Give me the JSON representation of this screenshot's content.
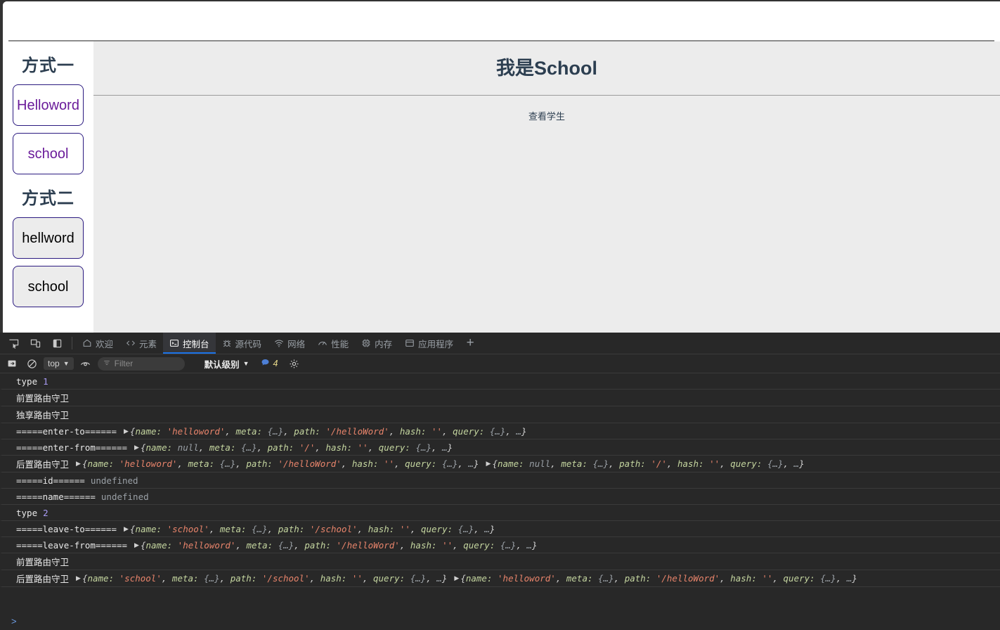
{
  "page": {
    "side_nav": {
      "section_one_heading": "方式一",
      "section_one_items": [
        {
          "label": "Helloword",
          "name": "nav-link-helloword"
        },
        {
          "label": "school",
          "name": "nav-link-school"
        }
      ],
      "section_two_heading": "方式二",
      "section_two_items": [
        {
          "label": "hellword",
          "name": "nav-button-hellword"
        },
        {
          "label": "school",
          "name": "nav-button-school"
        }
      ]
    },
    "content": {
      "title": "我是School",
      "sub_link": "查看学生"
    }
  },
  "devtools": {
    "tabs": [
      {
        "label": "欢迎",
        "icon": "home-icon",
        "active": false
      },
      {
        "label": "元素",
        "icon": "code-icon",
        "active": false
      },
      {
        "label": "控制台",
        "icon": "console-icon",
        "active": true
      },
      {
        "label": "源代码",
        "icon": "bug-icon",
        "active": false
      },
      {
        "label": "网络",
        "icon": "wifi-icon",
        "active": false
      },
      {
        "label": "性能",
        "icon": "gauge-icon",
        "active": false
      },
      {
        "label": "内存",
        "icon": "chip-icon",
        "active": false
      },
      {
        "label": "应用程序",
        "icon": "box-icon",
        "active": false
      }
    ],
    "add_tab_label": "+",
    "toolbar": {
      "context": "top",
      "filter_placeholder": "Filter",
      "level": "默认级别",
      "message_count": "4"
    },
    "prompt": ">",
    "colors": {
      "accent": "#1a73e8",
      "panel_bg": "#282828",
      "string": "#e8846b",
      "number": "#a99cf5",
      "key": "#c5d6a0"
    },
    "logs": [
      {
        "kind": "label-value",
        "label": "type",
        "label_cls": "lbl-white mono",
        "value": "1",
        "value_cls": "num mono"
      },
      {
        "kind": "text",
        "label": "前置路由守卫",
        "label_cls": "cjk"
      },
      {
        "kind": "text",
        "label": "独享路由守卫",
        "label_cls": "cjk"
      },
      {
        "kind": "label-object",
        "label": "=====enter-to======",
        "label_cls": "lbl-white mono",
        "objects": [
          {
            "name": "'helloword'",
            "name_cls": "s",
            "path": "'/helloWord'"
          }
        ]
      },
      {
        "kind": "label-object",
        "label": "=====enter-from======",
        "label_cls": "lbl-white mono",
        "objects": [
          {
            "name": "null",
            "name_cls": "n",
            "path": "'/'"
          }
        ]
      },
      {
        "kind": "label-object",
        "label": "后置路由守卫",
        "label_cls": "cjk",
        "objects": [
          {
            "name": "'helloword'",
            "name_cls": "s",
            "path": "'/helloWord'"
          },
          {
            "name": "null",
            "name_cls": "n",
            "path": "'/'"
          }
        ]
      },
      {
        "kind": "label-value",
        "label": "=====id======",
        "label_cls": "lbl-white mono",
        "value": "undefined",
        "value_cls": "undef mono"
      },
      {
        "kind": "label-value",
        "label": "=====name======",
        "label_cls": "lbl-white mono",
        "value": "undefined",
        "value_cls": "undef mono"
      },
      {
        "kind": "label-value",
        "label": "type",
        "label_cls": "lbl-white mono",
        "value": "2",
        "value_cls": "num mono"
      },
      {
        "kind": "label-object",
        "label": "=====leave-to======",
        "label_cls": "lbl-white mono",
        "objects": [
          {
            "name": "'school'",
            "name_cls": "s",
            "path": "'/school'"
          }
        ]
      },
      {
        "kind": "label-object",
        "label": "=====leave-from======",
        "label_cls": "lbl-white mono",
        "objects": [
          {
            "name": "'helloword'",
            "name_cls": "s",
            "path": "'/helloWord'"
          }
        ]
      },
      {
        "kind": "text",
        "label": "前置路由守卫",
        "label_cls": "cjk"
      },
      {
        "kind": "label-object",
        "label": "后置路由守卫",
        "label_cls": "cjk",
        "objects": [
          {
            "name": "'school'",
            "name_cls": "s",
            "path": "'/school'"
          },
          {
            "name": "'helloword'",
            "name_cls": "s",
            "path": "'/helloWord'"
          }
        ]
      }
    ],
    "object_tokens": {
      "open": "{",
      "k_name": "name:",
      "k_meta": "meta:",
      "v_meta": "{…}",
      "k_path": "path:",
      "k_hash": "hash:",
      "v_hash": "''",
      "k_query": "query:",
      "v_query": "{…}",
      "ellipsis": "…",
      "close": "}"
    }
  }
}
